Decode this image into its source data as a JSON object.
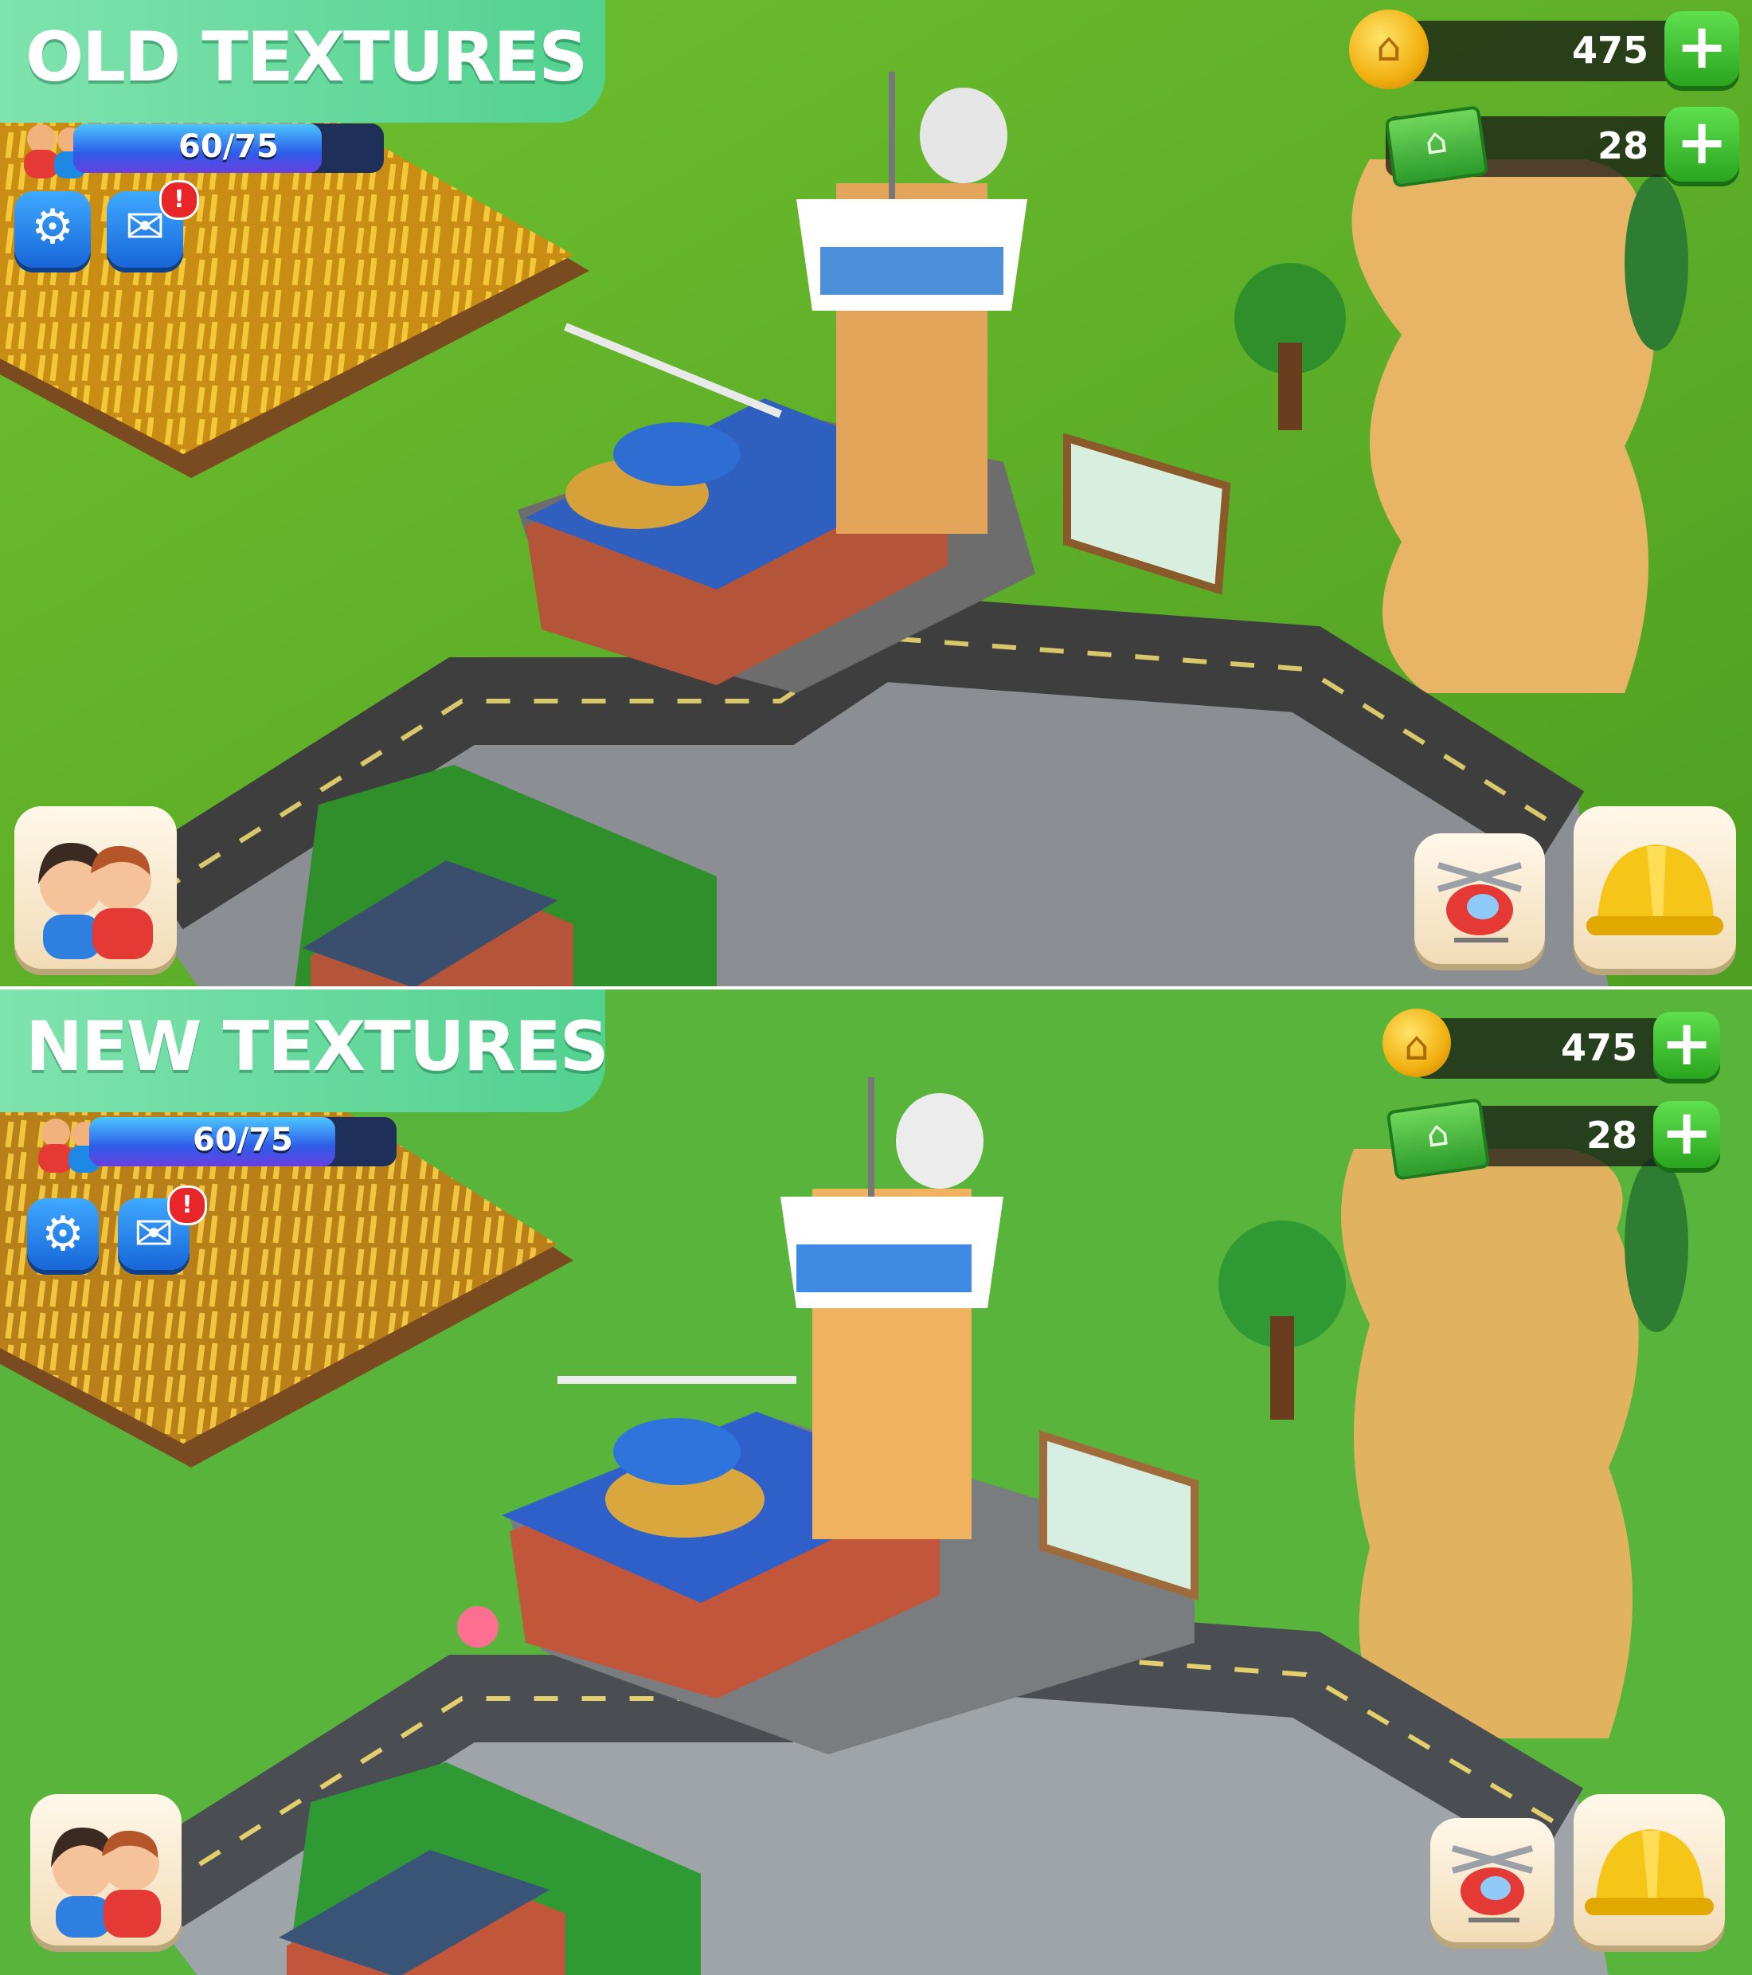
{
  "panels": [
    {
      "id": "old",
      "banner_label": "OLD TEXTURES",
      "xp": {
        "text": "60/75",
        "fraction": 0.8
      },
      "coins": {
        "value": "475",
        "icon": "coin-icon"
      },
      "cash": {
        "value": "28",
        "icon": "cash-icon"
      },
      "mail_badge": "!"
    },
    {
      "id": "new",
      "banner_label": "NEW TEXTURES",
      "xp": {
        "text": "60/75",
        "fraction": 0.8
      },
      "coins": {
        "value": "475",
        "icon": "coin-icon"
      },
      "cash": {
        "value": "28",
        "icon": "cash-icon"
      },
      "mail_badge": "!"
    }
  ],
  "icons": {
    "settings": "gear-icon",
    "mail": "mail-icon",
    "plus": "plus-icon",
    "friends": "friends-icon",
    "helicopter": "helicopter-icon",
    "build": "hard-hat-icon"
  },
  "colors": {
    "banner": "#5ad596",
    "grass_old": "#5fb52a",
    "grass_new": "#55b236",
    "road": "#3f3f3f",
    "plus_button": "#3cbf2e",
    "hud_button": "#2a86ea"
  }
}
